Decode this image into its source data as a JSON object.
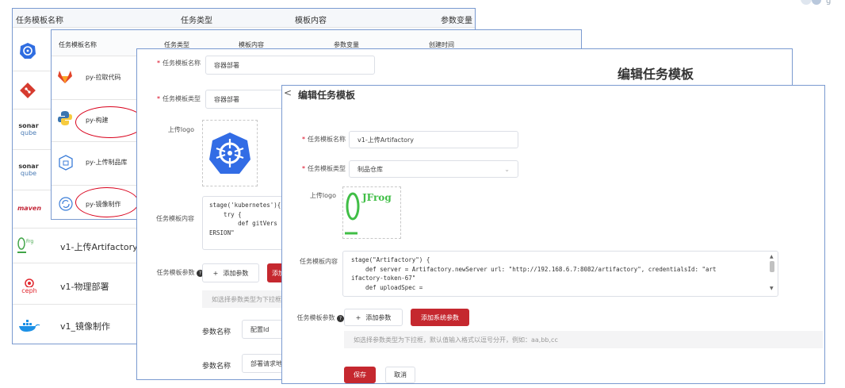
{
  "w1": {
    "headers": [
      "任务模板名称",
      "任务类型",
      "模板内容",
      "参数变量"
    ],
    "rows": [
      {
        "icon": "gitlab-icon",
        "name": ""
      },
      {
        "icon": "git-icon",
        "name": ""
      },
      {
        "icon": "sonarqube-icon",
        "name": ""
      },
      {
        "icon": "sonarqube-icon",
        "name": ""
      },
      {
        "icon": "maven-icon",
        "name": ""
      },
      {
        "icon": "jfrog-icon",
        "name": "v1-上传Artifactory"
      },
      {
        "icon": "ceph-icon",
        "name": "v1-物理部署"
      },
      {
        "icon": "docker-icon",
        "name": "v1_镜像制作"
      }
    ],
    "logo_text": {
      "sonar": "sonar",
      "qube": "qube",
      "maven": "maven",
      "ceph": "ceph"
    }
  },
  "w2": {
    "headers": [
      "任务模板名称",
      "任务类型",
      "模板内容",
      "参数变量",
      "创建时间"
    ],
    "rows": [
      {
        "icon": "gitlab-icon",
        "name": "py-拉取代码"
      },
      {
        "icon": "python-icon",
        "name": "py-构建"
      },
      {
        "icon": "package-icon",
        "name": "py-上传制品库"
      },
      {
        "icon": "refresh-icon",
        "name": "py-镜像制作"
      }
    ]
  },
  "w3": {
    "title": "编辑任务模板",
    "fields": {
      "name_label": "任务模板名称",
      "name_value": "容器部署",
      "type_label": "任务模板类型",
      "type_value": "容器部署",
      "logo_label": "上传logo",
      "content_label": "任务模板内容",
      "code_lines": [
        "stage('kubernetes'){",
        "    try {",
        "        def gitVers",
        "ERSION\""
      ],
      "params_label": "任务模板参数",
      "add_param": "添加参数",
      "add_system_param": "添加系统参数",
      "hint": "如选择参数类型为下拉框，默认值输入格式以逗号分开，例如：aa,bb,cc",
      "param_rows": [
        {
          "label": "参数名称",
          "value": "配置Id"
        },
        {
          "label": "参数名称",
          "value": "部署请求地址"
        }
      ]
    }
  },
  "w4": {
    "title": "编辑任务模板",
    "name_label": "任务模板名称",
    "name_value": "v1-上传Artifactory",
    "type_label": "任务模板类型",
    "type_value": "制品仓库",
    "logo_label": "上传logo",
    "logo_text": "JFrog",
    "content_label": "任务模板内容",
    "code_lines": [
      "stage(\"Artifactory\") {",
      "    def server = Artifactory.newServer url: \"http://192.168.6.7:8082/artifactory\", credentialsId: \"art",
      "ifactory-token-67\"",
      "    def uploadSpec ="
    ],
    "params_label": "任务模板参数",
    "add_param": "添加参数",
    "add_system_param": "添加系统参数",
    "hint": "如选择参数类型为下拉框，默认值输入格式以逗号分开，例如：aa,bb,cc",
    "save": "保存",
    "cancel": "取消"
  }
}
